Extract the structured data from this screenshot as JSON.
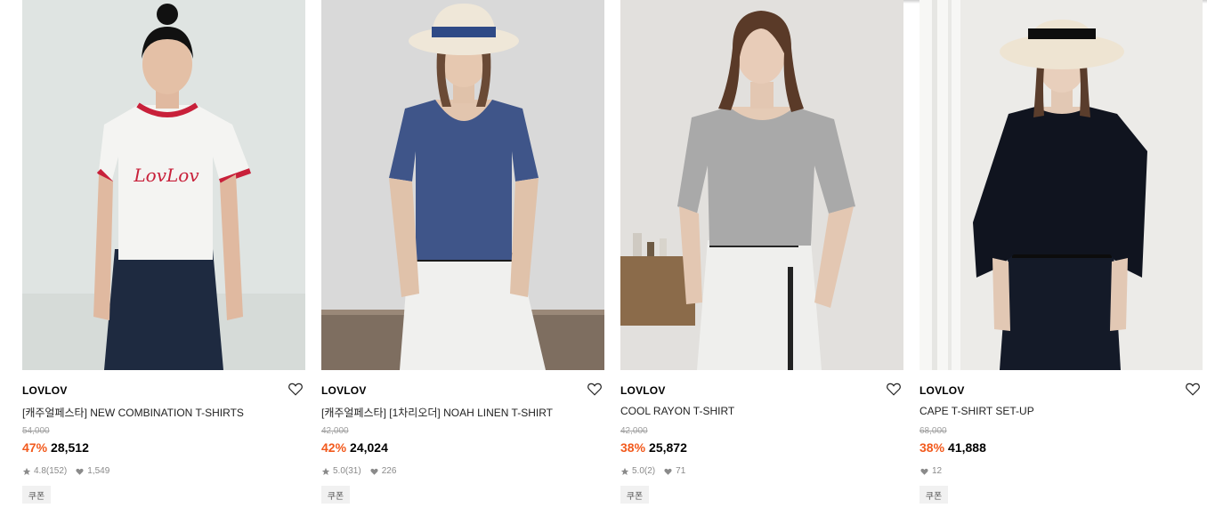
{
  "products": [
    {
      "brand": "LOVLOV",
      "title": "[캐주얼페스타] NEW COMBINATION T-SHIRTS",
      "original_price": "54,000",
      "discount": "47%",
      "sale_price": "28,512",
      "rating": "4.8",
      "review_count": "(152)",
      "likes": "1,549",
      "coupon": "쿠폰",
      "print": "LovLov"
    },
    {
      "brand": "LOVLOV",
      "title": "[캐주얼페스타] [1차리오더] NOAH LINEN T-SHIRT",
      "original_price": "42,000",
      "discount": "42%",
      "sale_price": "24,024",
      "rating": "5.0",
      "review_count": "(31)",
      "likes": "226",
      "coupon": "쿠폰"
    },
    {
      "brand": "LOVLOV",
      "title": "COOL RAYON T-SHIRT",
      "original_price": "42,000",
      "discount": "38%",
      "sale_price": "25,872",
      "rating": "5.0",
      "review_count": "(2)",
      "likes": "71",
      "coupon": "쿠폰"
    },
    {
      "brand": "LOVLOV",
      "title": "CAPE T-SHIRT SET-UP",
      "original_price": "68,000",
      "discount": "38%",
      "sale_price": "41,888",
      "likes": "12",
      "coupon": "쿠폰"
    }
  ],
  "icons": {
    "like": "heart-outline-icon",
    "rating": "star-icon",
    "likes_count": "heart-filled-icon"
  },
  "colors": {
    "discount": "#f25a1d",
    "original_price": "#a0a0a0",
    "meta": "#8a8a8a",
    "coupon_bg": "#f1f1f1"
  }
}
